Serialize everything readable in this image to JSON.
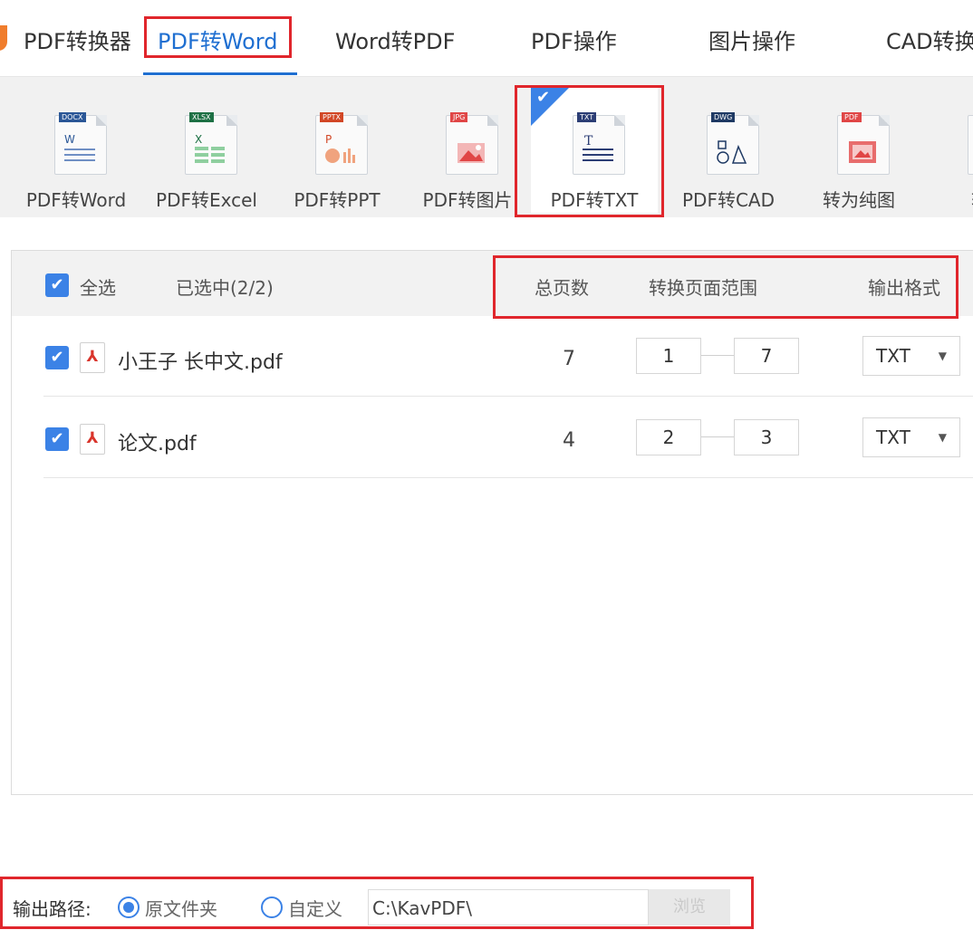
{
  "top_nav": {
    "items": [
      "PDF转换器",
      "PDF转Word",
      "Word转PDF",
      "PDF操作",
      "图片操作",
      "CAD转换"
    ],
    "active": "PDF转Word"
  },
  "tools": [
    {
      "label": "PDF转Word",
      "tag": "DOCX",
      "tag_color": "#2b5797"
    },
    {
      "label": "PDF转Excel",
      "tag": "XLSX",
      "tag_color": "#1e7145"
    },
    {
      "label": "PDF转PPT",
      "tag": "PPTX",
      "tag_color": "#d24726"
    },
    {
      "label": "PDF转图片",
      "tag": "JPG",
      "tag_color": "#e04646"
    },
    {
      "label": "PDF转TXT",
      "tag": "TXT",
      "tag_color": "#2c3e75",
      "selected": true
    },
    {
      "label": "PDF转CAD",
      "tag": "DWG",
      "tag_color": "#1f3a64"
    },
    {
      "label": "转为纯图",
      "tag": "PDF",
      "tag_color": "#e04646"
    },
    {
      "label": "转为",
      "tag": "",
      "tag_color": "#e04646"
    }
  ],
  "file_list": {
    "select_all_label": "全选",
    "selected_count": "已选中(2/2)",
    "columns": {
      "total_pages": "总页数",
      "page_range": "转换页面范围",
      "output_format": "输出格式"
    },
    "files": [
      {
        "name": "小王子 长中文.pdf",
        "pages": "7",
        "range_from": "1",
        "range_to": "7",
        "format": "TXT"
      },
      {
        "name": "论文.pdf",
        "pages": "4",
        "range_from": "2",
        "range_to": "3",
        "format": "TXT"
      }
    ]
  },
  "output": {
    "label": "输出路径:",
    "option_original": "原文件夹",
    "option_custom": "自定义",
    "path_value": "C:\\KavPDF\\",
    "browse_label": "浏览"
  },
  "colors": {
    "accent": "#3b82e6",
    "nav_active": "#1f6fd1",
    "highlight_red": "#e0262c"
  }
}
